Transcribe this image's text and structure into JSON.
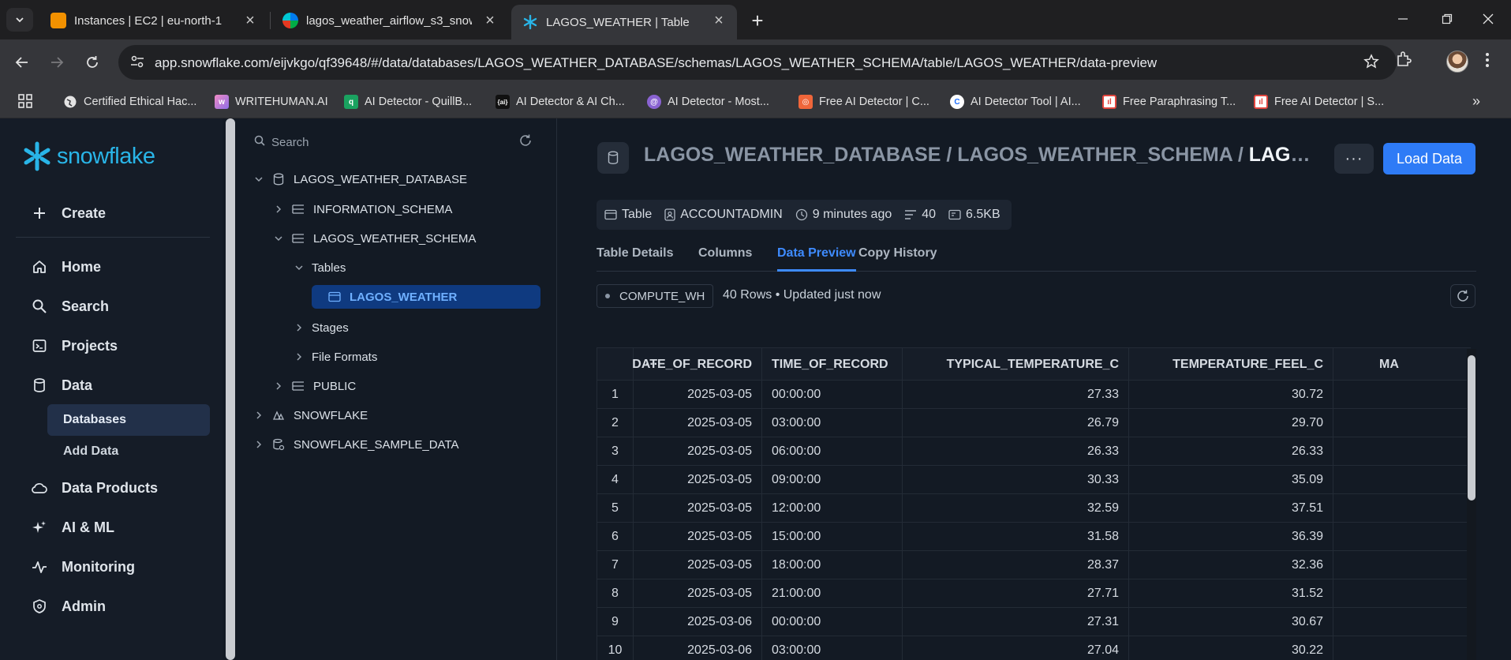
{
  "browser": {
    "tabs": [
      {
        "title": "Instances | EC2 | eu-north-1",
        "favicon_color": "#f29100"
      },
      {
        "title": "lagos_weather_airflow_s3_snow",
        "favicon_color": "#017cee"
      },
      {
        "title": "LAGOS_WEATHER | Table",
        "favicon_color": "#29b5e8"
      }
    ],
    "url_host": "app.snowflake.com",
    "url_path": "/eijvkgo/qf39648/#/data/databases/LAGOS_WEATHER_DATABASE/schemas/LAGOS_WEATHER_SCHEMA/table/LAGOS_WEATHER/data-preview",
    "bookmarks": [
      {
        "label": "Certified Ethical Hac...",
        "icon_color": "#8ab4f8"
      },
      {
        "label": "WRITEHUMAN.AI",
        "icon_color": "#c87ad6"
      },
      {
        "label": "AI Detector - QuillB...",
        "icon_color": "#1aa260"
      },
      {
        "label": "AI Detector & AI Ch...",
        "icon_color": "#111111"
      },
      {
        "label": "AI Detector - Most...",
        "icon_color": "#8a63d2"
      },
      {
        "label": "Free AI Detector | C...",
        "icon_color": "#f0663a"
      },
      {
        "label": "AI Detector Tool | AI...",
        "icon_color": "#1e6fff"
      },
      {
        "label": "Free Paraphrasing T...",
        "icon_color": "#e2463f"
      },
      {
        "label": "Free AI Detector | S...",
        "icon_color": "#e2463f"
      }
    ]
  },
  "sidebar": {
    "logo_text": "snowflake",
    "create_label": "Create",
    "items": [
      {
        "label": "Home",
        "icon": "home-icon"
      },
      {
        "label": "Search",
        "icon": "search-icon"
      },
      {
        "label": "Projects",
        "icon": "projects-icon"
      },
      {
        "label": "Data",
        "icon": "database-icon"
      }
    ],
    "data_sub": [
      "Databases",
      "Add Data"
    ],
    "items2": [
      {
        "label": "Data Products",
        "icon": "cloud-icon"
      },
      {
        "label": "AI & ML",
        "icon": "sparkle-icon"
      },
      {
        "label": "Monitoring",
        "icon": "pulse-icon"
      },
      {
        "label": "Admin",
        "icon": "shield-icon"
      }
    ]
  },
  "tree": {
    "search_placeholder": "Search",
    "nodes": {
      "db": "LAGOS_WEATHER_DATABASE",
      "info_schema": "INFORMATION_SCHEMA",
      "schema": "LAGOS_WEATHER_SCHEMA",
      "tables": "Tables",
      "table": "LAGOS_WEATHER",
      "stages": "Stages",
      "file_formats": "File Formats",
      "public": "PUBLIC",
      "snowflake": "SNOWFLAKE",
      "sample": "SNOWFLAKE_SAMPLE_DATA"
    }
  },
  "main": {
    "crumb_prefix": "LAGOS_WEATHER_DATABASE / LAGOS_WEATHER_SCHEMA / ",
    "crumb_last": "LAGOS_WEATHER",
    "more_label": "···",
    "load_label": "Load Data",
    "meta": {
      "type": "Table",
      "owner": "ACCOUNTADMIN",
      "updated": "9 minutes ago",
      "rows": "40",
      "size": "6.5KB"
    },
    "tabs": [
      "Table Details",
      "Columns",
      "Data Preview",
      "Copy History"
    ],
    "warehouse": "COMPUTE_WH",
    "rows_info": "40 Rows • Updated just now",
    "grid": {
      "menu_label": "···",
      "columns": [
        "DATE_OF_RECORD",
        "TIME_OF_RECORD",
        "TYPICAL_TEMPERATURE_C",
        "TEMPERATURE_FEEL_C",
        "MA"
      ],
      "rows": [
        [
          "1",
          "2025-03-05",
          "00:00:00",
          "27.33",
          "30.72"
        ],
        [
          "2",
          "2025-03-05",
          "03:00:00",
          "26.79",
          "29.70"
        ],
        [
          "3",
          "2025-03-05",
          "06:00:00",
          "26.33",
          "26.33"
        ],
        [
          "4",
          "2025-03-05",
          "09:00:00",
          "30.33",
          "35.09"
        ],
        [
          "5",
          "2025-03-05",
          "12:00:00",
          "32.59",
          "37.51"
        ],
        [
          "6",
          "2025-03-05",
          "15:00:00",
          "31.58",
          "36.39"
        ],
        [
          "7",
          "2025-03-05",
          "18:00:00",
          "28.37",
          "32.36"
        ],
        [
          "8",
          "2025-03-05",
          "21:00:00",
          "27.71",
          "31.52"
        ],
        [
          "9",
          "2025-03-06",
          "00:00:00",
          "27.31",
          "30.67"
        ],
        [
          "10",
          "2025-03-06",
          "03:00:00",
          "27.04",
          "30.22"
        ]
      ]
    }
  }
}
